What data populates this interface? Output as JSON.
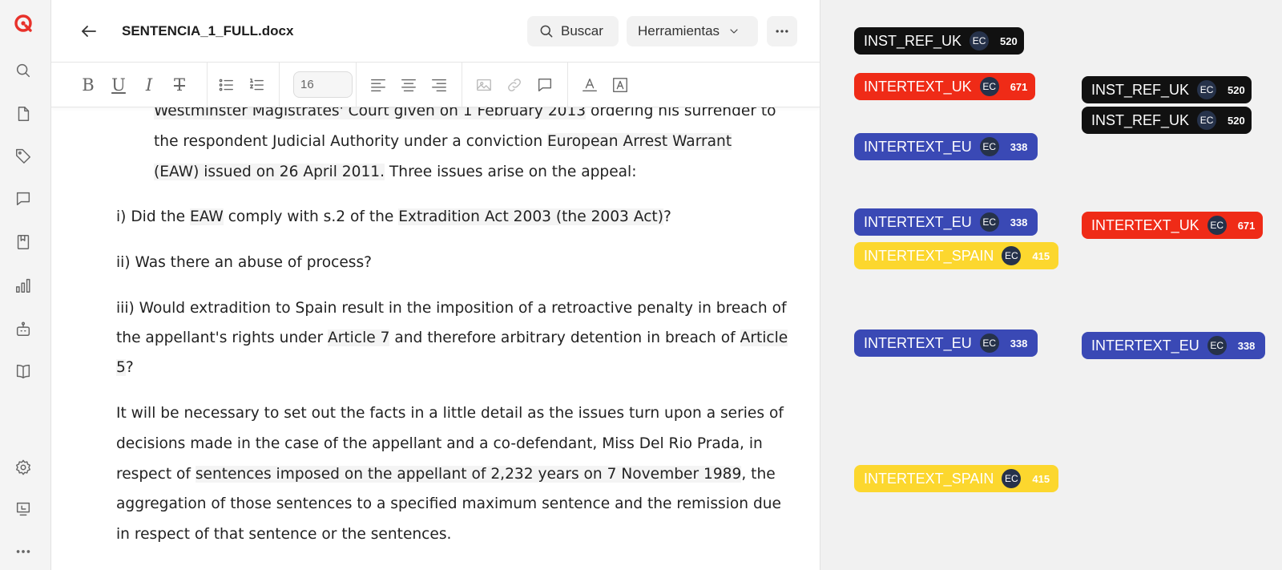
{
  "document": {
    "title": "SENTENCIA_1_FULL.docx",
    "lines": [
      {
        "segments": [
          {
            "text": "Westminster Magistrates' Court given on 1 February 2013",
            "hl": true
          },
          {
            "text": " ordering his surrender to",
            "hl": false
          }
        ]
      },
      {
        "segments": [
          {
            "text": "the respondent Judicial Authority under a conviction ",
            "hl": false
          },
          {
            "text": "European Arrest Warrant",
            "hl": true
          }
        ]
      },
      {
        "segments": [
          {
            "text": "(EAW) issued on 26 April 2011.",
            "hl": true
          },
          {
            "text": " Three issues arise on the appeal:",
            "hl": false
          }
        ]
      },
      {
        "segments": [
          {
            "text": "i) Did the ",
            "hl": false
          },
          {
            "text": "EAW",
            "hl": true
          },
          {
            "text": " comply with s.2 of the ",
            "hl": false
          },
          {
            "text": "Extradition Act 2003 (the 2003 Act)",
            "hl": true
          },
          {
            "text": "?",
            "hl": false
          }
        ]
      },
      {
        "segments": [
          {
            "text": "ii) Was there an abuse of process?",
            "hl": false
          }
        ]
      },
      {
        "segments": [
          {
            "text": "iii) Would extradition to Spain result in the imposition of a retroactive penalty in breach of",
            "hl": false
          }
        ]
      },
      {
        "segments": [
          {
            "text": "the appellant's rights under ",
            "hl": false
          },
          {
            "text": "Article 7",
            "hl": true
          },
          {
            "text": " and therefore arbitrary detention in breach of ",
            "hl": false
          },
          {
            "text": "Article",
            "hl": true
          }
        ]
      },
      {
        "segments": [
          {
            "text": "5",
            "hl": true
          },
          {
            "text": "?",
            "hl": false
          }
        ]
      },
      {
        "segments": [
          {
            "text": "It will be necessary to set out the facts in a little detail as the issues turn upon a series of",
            "hl": false
          }
        ]
      },
      {
        "segments": [
          {
            "text": "decisions made in the case of the appellant and a co-defendant, Miss Del Rio Prada, in",
            "hl": false
          }
        ]
      },
      {
        "segments": [
          {
            "text": "respect of ",
            "hl": false
          },
          {
            "text": "sentences imposed on the appellant of 2,232 years on 7 November 1989",
            "hl": true
          },
          {
            "text": ", the",
            "hl": false
          }
        ]
      },
      {
        "segments": [
          {
            "text": "aggregation of those sentences to a specified maximum sentence and the remission due",
            "hl": false
          }
        ]
      },
      {
        "segments": [
          {
            "text": "in respect of that sentence or the sentences.",
            "hl": false
          }
        ]
      }
    ]
  },
  "header": {
    "search_label": "Buscar",
    "tools_label": "Herramientas"
  },
  "toolbar": {
    "bold": "B",
    "underline": "U",
    "italic": "I",
    "strike": "T",
    "font_size": "16"
  },
  "tags": [
    {
      "label": "INST_REF_UK",
      "badge": "EC",
      "count": "520",
      "color": "#111111",
      "text_color": "#ffffff"
    },
    {
      "label": "INTERTEXT_UK",
      "badge": "EC",
      "count": "671",
      "color": "#ef2b17",
      "text_color": "#ffffff"
    },
    {
      "label": "INST_REF_UK",
      "badge": "EC",
      "count": "520",
      "color": "#111111",
      "text_color": "#ffffff"
    },
    {
      "label": "INST_REF_UK",
      "badge": "EC",
      "count": "520",
      "color": "#111111",
      "text_color": "#ffffff"
    },
    {
      "label": "INTERTEXT_EU",
      "badge": "EC",
      "count": "338",
      "color": "#3a49b5",
      "text_color": "#ffffff"
    },
    {
      "label": "INTERTEXT_EU",
      "badge": "EC",
      "count": "338",
      "color": "#3a49b5",
      "text_color": "#ffffff"
    },
    {
      "label": "INTERTEXT_UK",
      "badge": "EC",
      "count": "671",
      "color": "#ef2b17",
      "text_color": "#ffffff"
    },
    {
      "label": "INTERTEXT_SPAIN",
      "badge": "EC",
      "count": "415",
      "color": "#fcd72e",
      "text_color": "#ffffff"
    },
    {
      "label": "INTERTEXT_EU",
      "badge": "EC",
      "count": "338",
      "color": "#3a49b5",
      "text_color": "#ffffff"
    },
    {
      "label": "INTERTEXT_EU",
      "badge": "EC",
      "count": "338",
      "color": "#3a49b5",
      "text_color": "#ffffff"
    },
    {
      "label": "INTERTEXT_SPAIN",
      "badge": "EC",
      "count": "415",
      "color": "#fcd72e",
      "text_color": "#ffffff"
    }
  ],
  "colors": {
    "accent": "#e8312a",
    "highlight": "#f4f4f4"
  },
  "icons": {
    "rail": [
      "logo-icon",
      "search-icon",
      "file-icon",
      "tag-icon",
      "comment-icon",
      "bookmark-icon",
      "chart-icon",
      "robot-icon",
      "book-icon",
      "settings-icon",
      "export-icon",
      "more-icon"
    ]
  }
}
